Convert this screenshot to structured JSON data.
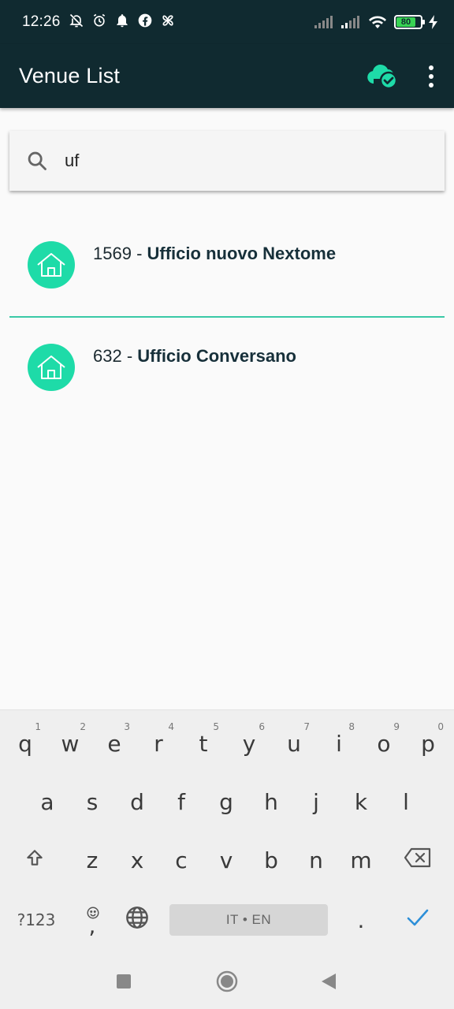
{
  "status_bar": {
    "time": "12:26",
    "battery_level": "80",
    "battery_color": "#39d353"
  },
  "app_bar": {
    "title": "Venue List",
    "actions": [
      "cloud-sync-icon",
      "more-vert-icon"
    ],
    "background": "#102a30"
  },
  "search": {
    "value": "uf",
    "icon": "search-icon"
  },
  "venues": [
    {
      "id": "1569",
      "separator": " - ",
      "name": "Ufficio nuovo Nextome",
      "icon": "home-icon"
    },
    {
      "id": "632",
      "separator": " - ",
      "name": "Ufficio Conversano",
      "icon": "home-icon"
    }
  ],
  "accent_color": "#1edba8",
  "keyboard": {
    "row1": [
      "q",
      "w",
      "e",
      "r",
      "t",
      "y",
      "u",
      "i",
      "o",
      "p"
    ],
    "row1_numbers": [
      "1",
      "2",
      "3",
      "4",
      "5",
      "6",
      "7",
      "8",
      "9",
      "0"
    ],
    "row2": [
      "a",
      "s",
      "d",
      "f",
      "g",
      "h",
      "j",
      "k",
      "l"
    ],
    "row3": [
      "z",
      "x",
      "c",
      "v",
      "b",
      "n",
      "m"
    ],
    "symbols_label": "?123",
    "comma_label": ",",
    "space_label": "IT • EN",
    "period_label": "."
  }
}
